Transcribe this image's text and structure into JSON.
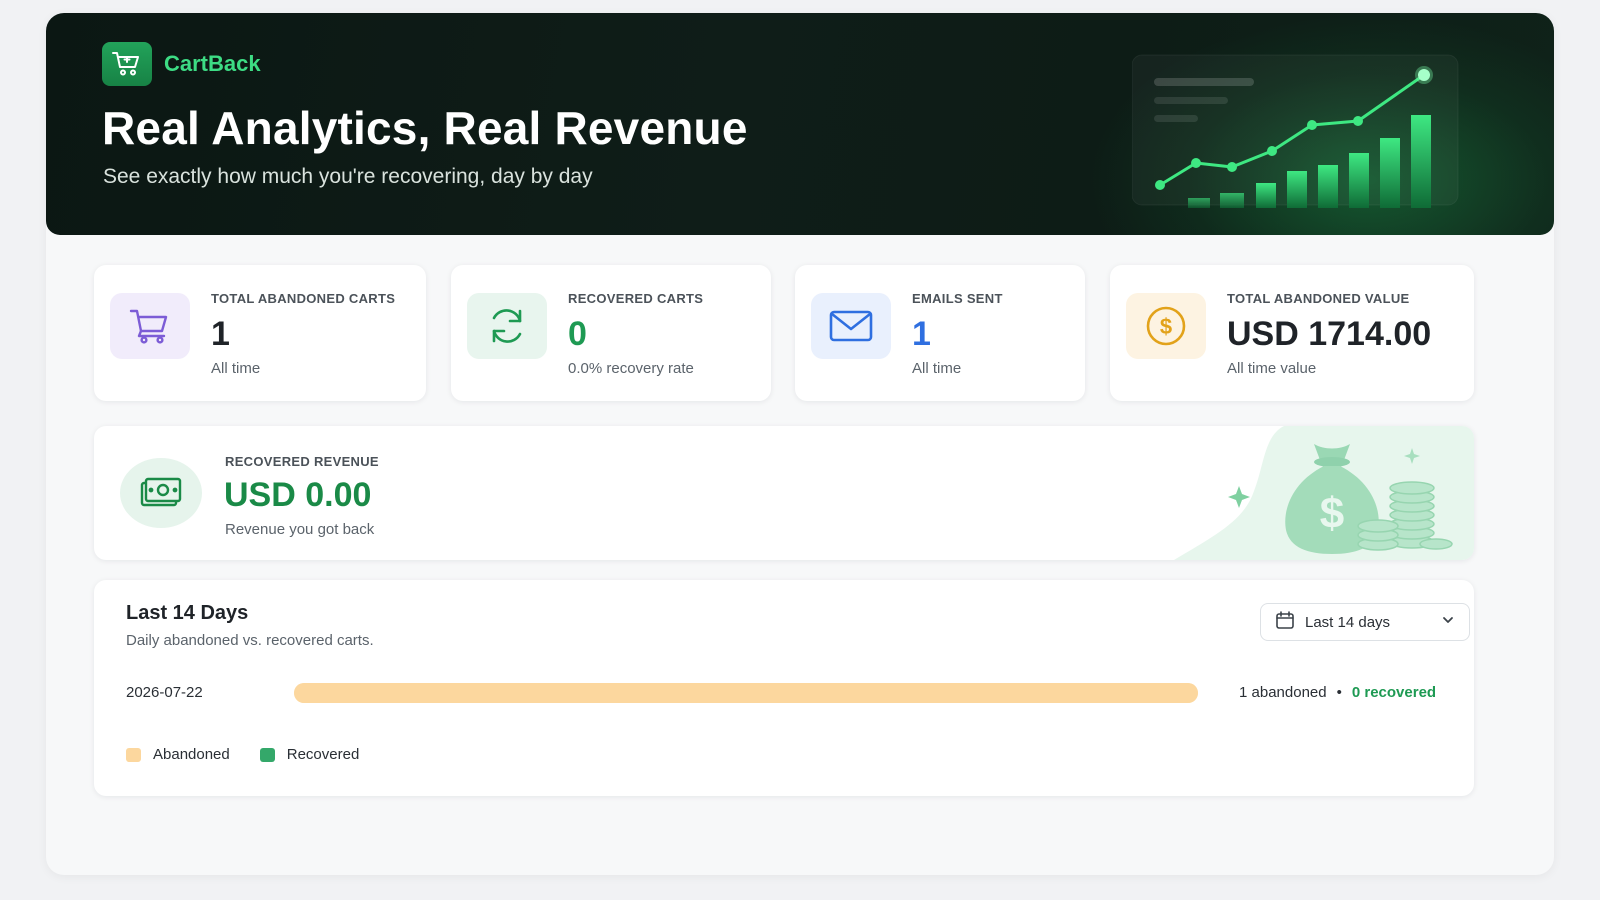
{
  "brand": {
    "name": "CartBack",
    "icon": "shopping-cart-icon"
  },
  "hero": {
    "title": "Real Analytics, Real Revenue",
    "subtitle": "See exactly how much you're recovering, day by day"
  },
  "stats": [
    {
      "label": "TOTAL ABANDONED CARTS",
      "value": "1",
      "sub": "All time",
      "icon": "shopping-cart-icon",
      "icon_color": "#7c5cd6",
      "icon_bg": "#f1ecfb",
      "value_color": "#1f2328"
    },
    {
      "label": "RECOVERED CARTS",
      "value": "0",
      "sub": "0.0% recovery rate",
      "icon": "refresh-icon",
      "icon_color": "#1e9a53",
      "icon_bg": "#e8f5ee",
      "value_color": "#1e9a53"
    },
    {
      "label": "EMAILS SENT",
      "value": "1",
      "sub": "All time",
      "icon": "mail-icon",
      "icon_color": "#2f6fe0",
      "icon_bg": "#e9f0fd",
      "value_color": "#2f6fe0"
    },
    {
      "label": "TOTAL ABANDONED VALUE",
      "value": "USD 1714.00",
      "sub": "All time value",
      "icon": "dollar-coin-icon",
      "icon_color": "#e2a21a",
      "icon_bg": "#fdf3e2",
      "value_color": "#1f2328"
    }
  ],
  "revenue": {
    "label": "RECOVERED REVENUE",
    "value": "USD 0.00",
    "sub": "Revenue you got back",
    "icon": "cash-icon",
    "accent": "#1a8a47"
  },
  "daily": {
    "title": "Last 14 Days",
    "subtitle": "Daily abandoned vs. recovered carts.",
    "range_select": "Last 14 days",
    "rows": [
      {
        "date": "2026-07-22",
        "abandoned_text": "1 abandoned",
        "separator": "•",
        "recovered_text": "0 recovered",
        "abandoned": 1,
        "recovered": 0
      }
    ],
    "legend": [
      {
        "label": "Abandoned",
        "color": "#fcd79e"
      },
      {
        "label": "Recovered",
        "color": "#34a86a"
      }
    ]
  }
}
